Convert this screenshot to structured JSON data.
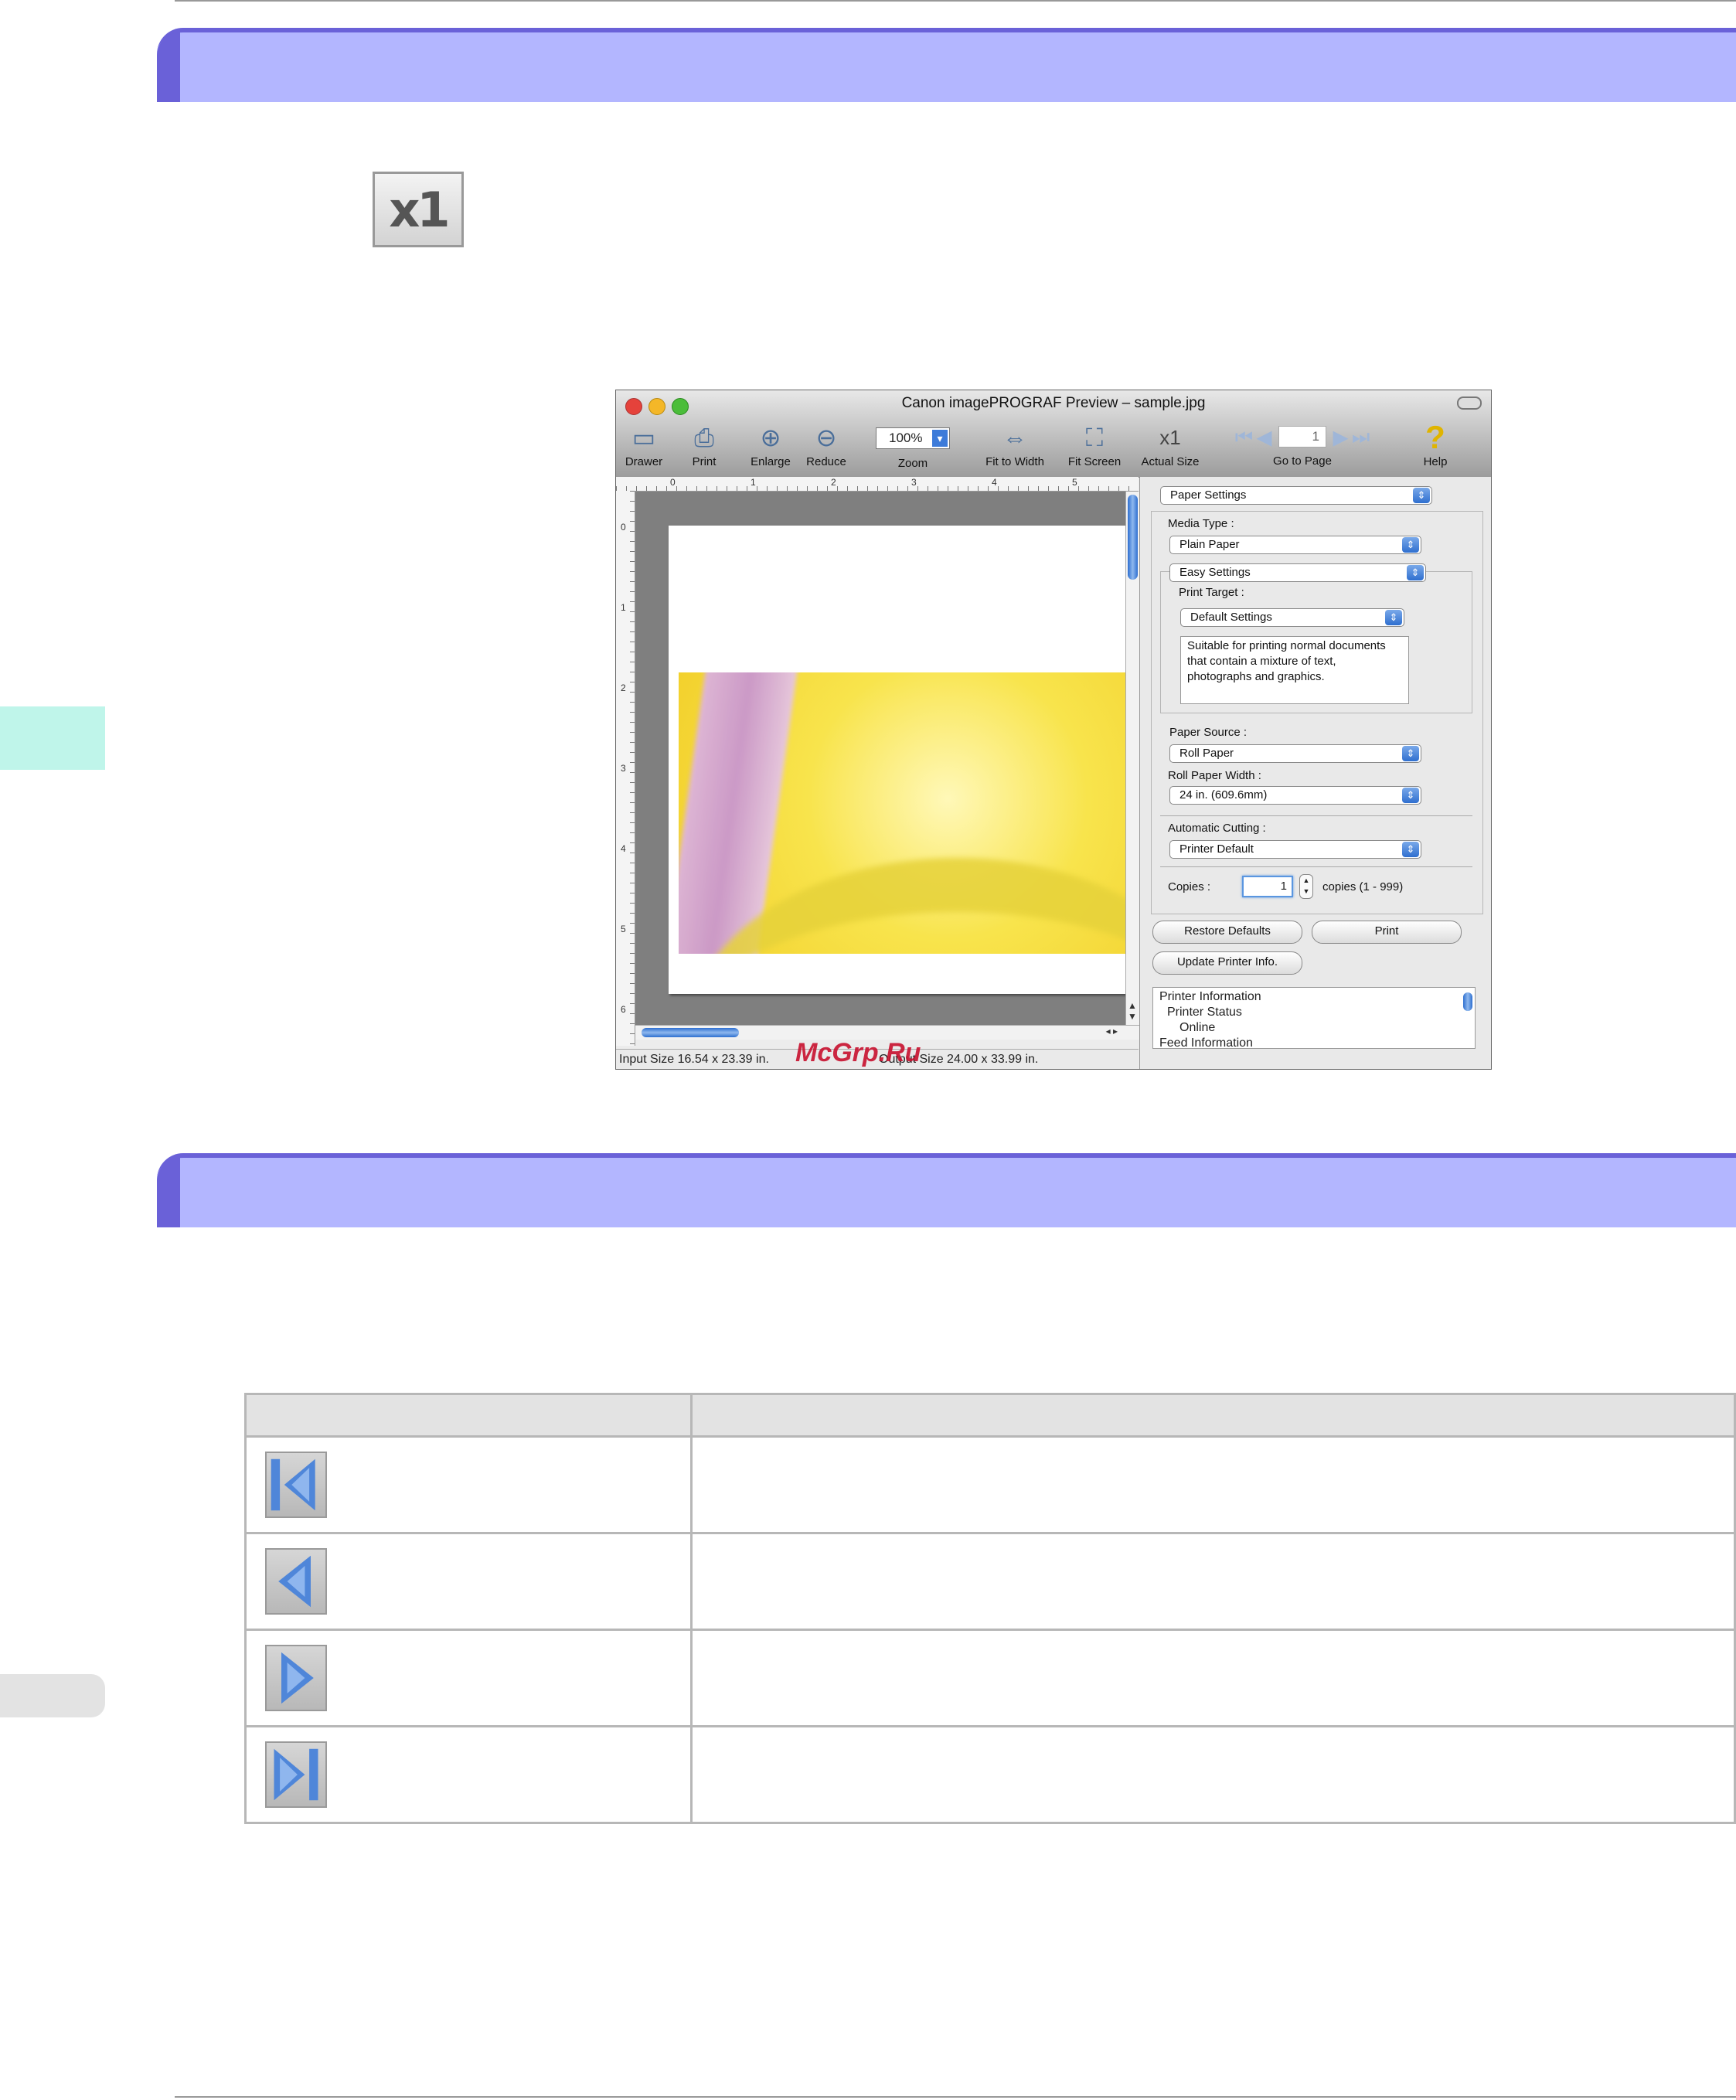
{
  "page": {
    "section1_heading": "",
    "section2_heading": ""
  },
  "actual_size_icon": {
    "text": "x1",
    "icon": "actual-size-icon"
  },
  "preview_window": {
    "title": "Canon imagePROGRAF Preview – sample.jpg",
    "toolbar": {
      "drawer": "Drawer",
      "print": "Print",
      "enlarge": "Enlarge",
      "reduce": "Reduce",
      "zoom_value": "100%",
      "zoom": "Zoom",
      "fit_to_width": "Fit to Width",
      "fit_screen": "Fit Screen",
      "actual_size": "Actual Size",
      "actual_size_glyph": "x1",
      "page_number": "1",
      "go_to_page": "Go to Page",
      "help": "Help"
    },
    "ruler_h": [
      "0",
      "1",
      "2",
      "3",
      "4",
      "5"
    ],
    "ruler_v": [
      "0",
      "1",
      "2",
      "3",
      "4",
      "5",
      "6"
    ],
    "status": {
      "input_size": "Input Size 16.54 x 23.39 in.",
      "output_size": "Output Size 24.00 x 33.99 in."
    },
    "watermark": "McGrp.Ru",
    "settings": {
      "sheet": "Paper Settings",
      "media_type_label": "Media Type :",
      "media_type": "Plain Paper",
      "mode": "Easy Settings",
      "print_target_label": "Print Target :",
      "print_target": "Default Settings",
      "description": "Suitable for printing normal documents that contain a mixture of text, photographs and graphics.",
      "paper_source_label": "Paper Source :",
      "paper_source": "Roll Paper",
      "roll_width_label": "Roll Paper Width :",
      "roll_width": "24 in. (609.6mm)",
      "auto_cut_label": "Automatic Cutting :",
      "auto_cut": "Printer Default",
      "copies_label": "Copies :",
      "copies_value": "1",
      "copies_range": "copies (1 - 999)",
      "restore_defaults": "Restore Defaults",
      "print": "Print",
      "update_info": "Update Printer Info.",
      "info_lines": [
        "Printer Information",
        "Printer Status",
        "Online",
        "Feed Information"
      ]
    }
  },
  "nav_table": {
    "headers": [
      "",
      ""
    ],
    "rows": [
      {
        "icon": "first-page-icon",
        "description": ""
      },
      {
        "icon": "previous-page-icon",
        "description": ""
      },
      {
        "icon": "next-page-icon",
        "description": ""
      },
      {
        "icon": "last-page-icon",
        "description": ""
      }
    ]
  },
  "colors": {
    "section_bar": "#b3b6ff",
    "section_accent": "#6a61d8",
    "side_tab": "#bff5ea",
    "table_border": "#b7b7b7",
    "nav_arrow": "#4f86d9"
  }
}
